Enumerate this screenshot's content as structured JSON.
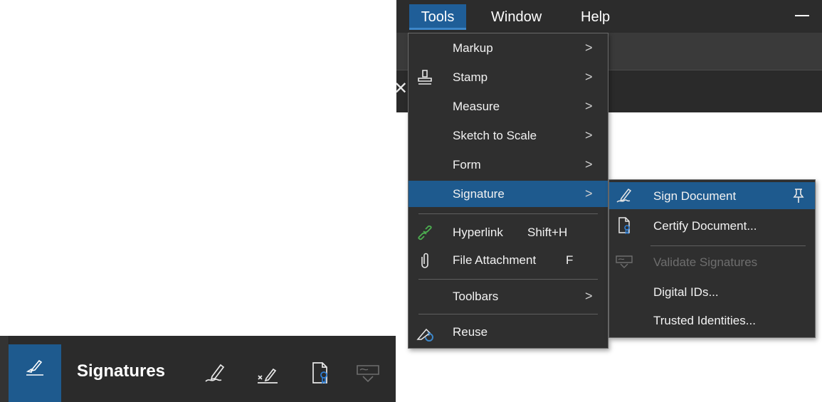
{
  "menubar": {
    "items": [
      "Tools",
      "Window",
      "Help"
    ]
  },
  "tools_menu": {
    "items": [
      {
        "label": "Markup",
        "submenu": true
      },
      {
        "label": "Stamp",
        "submenu": true,
        "icon": "stamp-icon"
      },
      {
        "label": "Measure",
        "submenu": true
      },
      {
        "label": "Sketch to Scale",
        "submenu": true
      },
      {
        "label": "Form",
        "submenu": true
      },
      {
        "label": "Signature",
        "submenu": true,
        "highlighted": true
      },
      {
        "label": "Hyperlink",
        "shortcut": "Shift+H",
        "icon": "hyperlink-icon"
      },
      {
        "label": "File Attachment",
        "shortcut": "F",
        "icon": "paperclip-icon"
      },
      {
        "label": "Toolbars",
        "submenu": true
      },
      {
        "label": "Reuse",
        "icon": "reuse-icon"
      }
    ],
    "arrow_glyph": ">"
  },
  "signature_submenu": {
    "items": [
      {
        "label": "Sign Document",
        "highlighted": true,
        "icon": "sign-pen-icon",
        "pinnable": true
      },
      {
        "label": "Certify Document...",
        "icon": "certify-document-icon"
      },
      {
        "label": "Validate Signatures",
        "disabled": true,
        "icon": "validate-signature-icon"
      },
      {
        "label": "Digital IDs..."
      },
      {
        "label": "Trusted Identities..."
      }
    ]
  },
  "signatures_toolbar": {
    "title": "Signatures",
    "tools": [
      "signature-tool-icon",
      "sign-pen-icon",
      "x-signature-icon",
      "certify-document-icon",
      "validate-signature-icon"
    ]
  },
  "colors": {
    "menu_bg": "#2f2f2f",
    "highlight": "#1e5a8e",
    "text": "#f2f2f2",
    "disabled_text": "#6e6e6e",
    "hyperlink_icon": "#4caf50",
    "certify_accent": "#2f7fd6"
  }
}
